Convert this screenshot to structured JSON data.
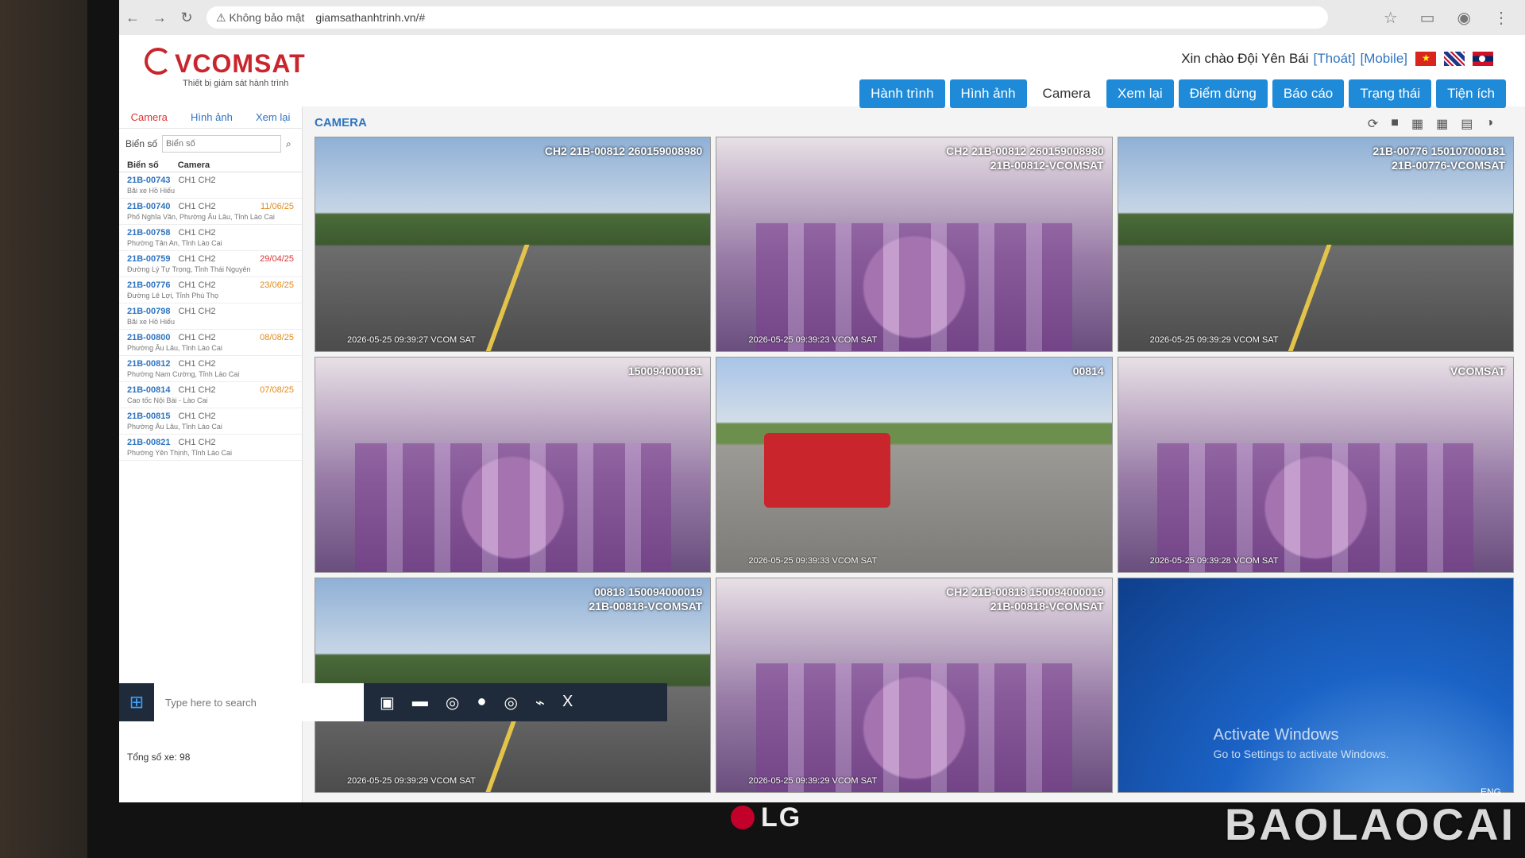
{
  "browser": {
    "security_label": "⚠ Không bảo mật",
    "url": "giamsathanhtrinh.vn/#"
  },
  "header": {
    "brand_name": "VCOMSAT",
    "brand_tagline": "Thiết bị giám sát hành trình",
    "greeting_prefix": "Xin chào Đội Yên Bái",
    "logout_link": "[Thoát]",
    "mobile_link": "[Mobile]"
  },
  "nav": {
    "tabs": [
      "Hành trình",
      "Hình ảnh",
      "Camera",
      "Xem lại",
      "Điểm dừng",
      "Báo cáo",
      "Trạng thái",
      "Tiện ích"
    ]
  },
  "sidebar": {
    "tabs": [
      "Camera",
      "Hình ảnh",
      "Xem lại"
    ],
    "search_label": "Biển số",
    "search_placeholder": "Biển số",
    "col_plate": "Biển số",
    "col_camera": "Camera",
    "footer": "Tổng số xe: 98",
    "vehicles": [
      {
        "plate": "21B-00743",
        "cams": "CH1 CH2",
        "expiry": "",
        "addr": "Bãi xe Hồ Hiếu"
      },
      {
        "plate": "21B-00740",
        "cams": "CH1 CH2",
        "expiry": "11/06/25",
        "addr": "Phố Nghĩa Văn, Phường Âu Lâu, Tỉnh Lào Cai"
      },
      {
        "plate": "21B-00758",
        "cams": "CH1 CH2",
        "expiry": "",
        "addr": "Phường Tân An, Tỉnh Lào Cai"
      },
      {
        "plate": "21B-00759",
        "cams": "CH1 CH2",
        "expiry": "29/04/25",
        "addr": "Đường Lý Tự Trọng, Tỉnh Thái Nguyên"
      },
      {
        "plate": "21B-00776",
        "cams": "CH1 CH2",
        "expiry": "23/06/25",
        "addr": "Đường Lê Lợi, Tỉnh Phú Thọ"
      },
      {
        "plate": "21B-00798",
        "cams": "CH1 CH2",
        "expiry": "",
        "addr": "Bãi xe Hồ Hiếu"
      },
      {
        "plate": "21B-00800",
        "cams": "CH1 CH2",
        "expiry": "08/08/25",
        "addr": "Phường Âu Lâu, Tỉnh Lào Cai"
      },
      {
        "plate": "21B-00812",
        "cams": "CH1 CH2",
        "expiry": "",
        "addr": "Phường Nam Cường, Tỉnh Lào Cai"
      },
      {
        "plate": "21B-00814",
        "cams": "CH1 CH2",
        "expiry": "07/08/25",
        "addr": "Cao tốc Nội Bài - Lào Cai"
      },
      {
        "plate": "21B-00815",
        "cams": "CH1 CH2",
        "expiry": "",
        "addr": "Phường Âu Lâu, Tỉnh Lào Cai"
      },
      {
        "plate": "21B-00821",
        "cams": "CH1 CH2",
        "expiry": "",
        "addr": "Phường Yên Thịnh, Tỉnh Lào Cai"
      }
    ]
  },
  "main": {
    "section_title": "CAMERA",
    "cameras": [
      {
        "label": "CH2 21B-00812 260159008980",
        "sub": "",
        "stamp": "2026-05-25 09:39:27 VCOM SAT"
      },
      {
        "label": "CH2 21B-00812 260159008980",
        "sub": "21B-00812-VCOMSAT",
        "stamp": "2026-05-25 09:39:23 VCOM SAT"
      },
      {
        "label": "21B-00776 150107000181",
        "sub": "21B-00776-VCOMSAT",
        "stamp": "2026-05-25 09:39:29 VCOM SAT"
      },
      {
        "label": "150094000181",
        "sub": "",
        "stamp": ""
      },
      {
        "label": "00814",
        "sub": "",
        "stamp": "2026-05-25 09:39:33 VCOM SAT"
      },
      {
        "label": "VCOMSAT",
        "sub": "",
        "stamp": "2026-05-25 09:39:28 VCOM SAT"
      },
      {
        "label": "00818 150094000019",
        "sub": "21B-00818-VCOMSAT",
        "stamp": "2026-05-25 09:39:29 VCOM SAT"
      },
      {
        "label": "CH2 21B-00818 150094000019",
        "sub": "21B-00818-VCOMSAT",
        "stamp": "2026-05-25 09:39:29 VCOM SAT"
      },
      {
        "label": "",
        "sub": "",
        "stamp": ""
      }
    ],
    "activate_title": "Activate Windows",
    "activate_sub": "Go to Settings to activate Windows."
  },
  "taskbar": {
    "search_placeholder": "Type here to search",
    "language": "ENG"
  },
  "monitor": {
    "brand": "LG"
  },
  "watermark": "BAOLAOCAI"
}
